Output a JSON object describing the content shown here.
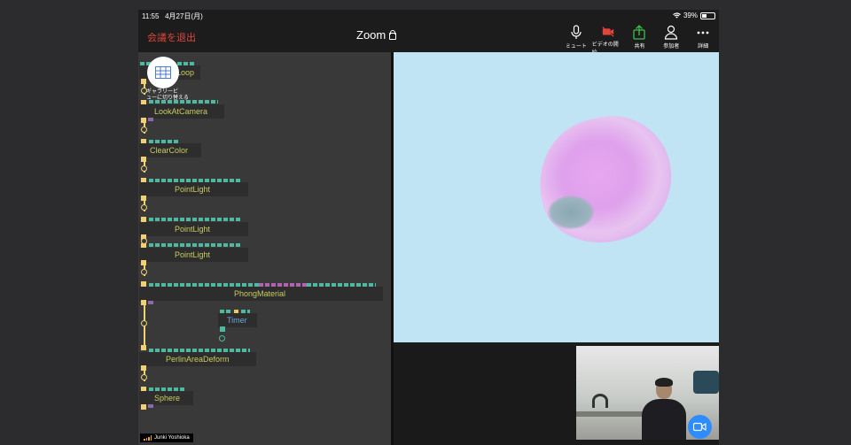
{
  "status_bar": {
    "time": "11:55",
    "date": "4月27日(月)",
    "battery": "39%"
  },
  "meeting": {
    "leave_label": "会議を退出",
    "title": "Zoom"
  },
  "toolbar": {
    "items": [
      {
        "label": "ミュート",
        "icon": "microphone-icon"
      },
      {
        "label": "ビデオの開始",
        "icon": "video-off-icon",
        "color": "#e0463b"
      },
      {
        "label": "共有",
        "icon": "share-icon",
        "color": "#3cc04a"
      },
      {
        "label": "参加者",
        "icon": "participants-icon"
      },
      {
        "label": "詳細",
        "icon": "more-icon"
      }
    ]
  },
  "gallery_toggle": {
    "label_line1": "ギャラリービ",
    "label_line2": "ューに切り替える"
  },
  "nodes": {
    "loop": "Loop",
    "lookat": "LookAtCamera",
    "clearcolor": "ClearColor",
    "pointlight1": "PointLight",
    "pointlight2": "PointLight",
    "pointlight3": "PointLight",
    "phong": "PhongMaterial",
    "timer": "Timer",
    "deform": "PerlinAreaDeform",
    "sphere": "Sphere"
  },
  "participant_name": "Junki Yoshioka",
  "colors": {
    "accent": "#2d8cff",
    "leave": "#e0463b",
    "node_text": "#c8cc60",
    "viewport_bg": "#c0e4f4",
    "blob": "#e0a4ee"
  }
}
